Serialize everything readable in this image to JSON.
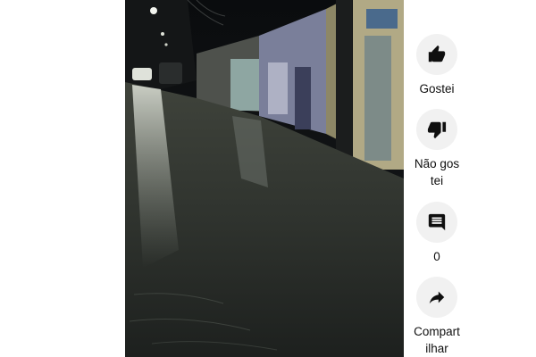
{
  "video": {
    "scene": "Flooded street at night"
  },
  "actions": {
    "like": {
      "label": "Gostei",
      "icon": "thumbs-up-icon"
    },
    "dislike": {
      "label": "Não gostei",
      "icon": "thumbs-down-icon"
    },
    "comments": {
      "count": "0",
      "icon": "comment-icon"
    },
    "share": {
      "label": "Compartilhar",
      "icon": "share-icon"
    }
  },
  "colors": {
    "button_bg": "#f1f1f1",
    "icon": "#0f0f0f",
    "video_bg": "#0f1010"
  }
}
